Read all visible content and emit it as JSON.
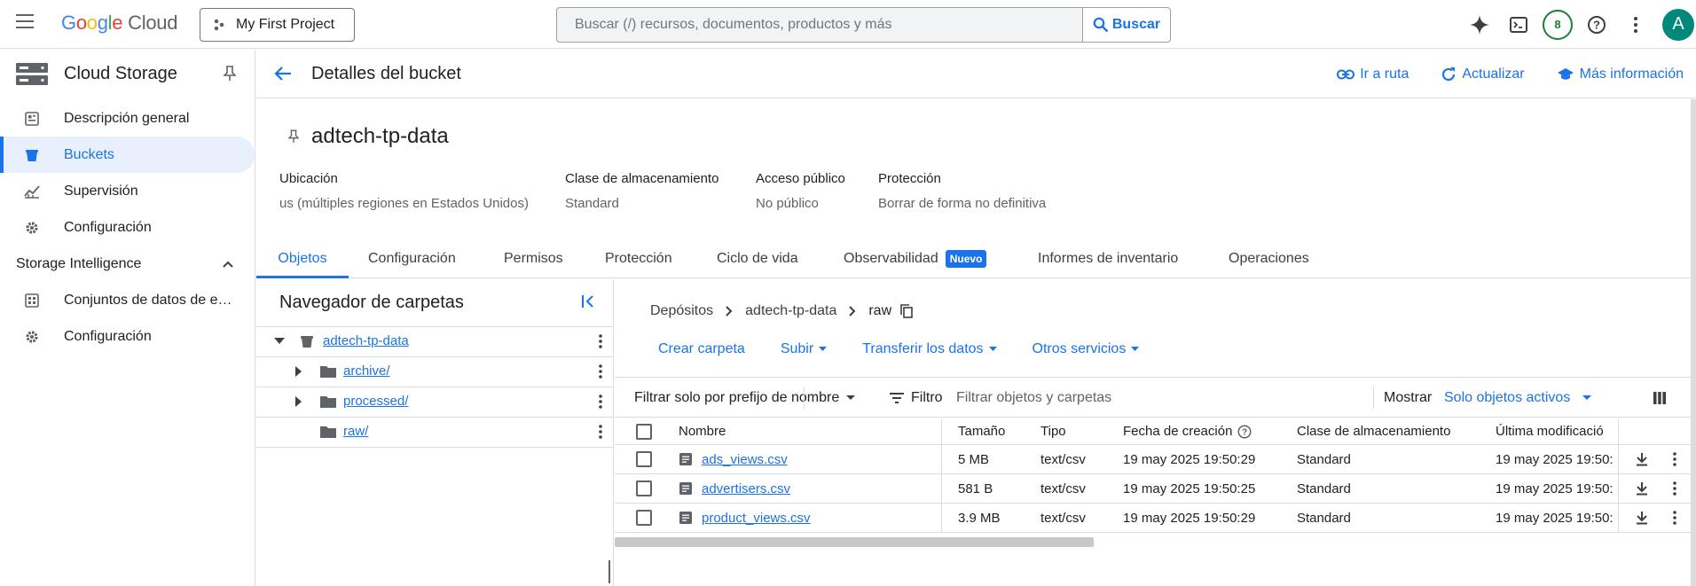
{
  "topbar": {
    "logo_google": "Google",
    "logo_cloud": "Cloud",
    "project_label": "My First Project",
    "search_placeholder": "Buscar (/) recursos, documentos, productos y más",
    "search_button": "Buscar",
    "notifications_count": "8",
    "avatar_letter": "A"
  },
  "sidebar": {
    "title": "Cloud Storage",
    "items": [
      {
        "label": "Descripción general",
        "icon": "dashboard-icon"
      },
      {
        "label": "Buckets",
        "icon": "bucket-icon",
        "active": true
      },
      {
        "label": "Supervisión",
        "icon": "monitoring-icon"
      },
      {
        "label": "Configuración",
        "icon": "gear-icon"
      }
    ],
    "section_title": "Storage Intelligence",
    "section_items": [
      {
        "label": "Conjuntos de datos de es…",
        "icon": "datasets-icon"
      },
      {
        "label": "Configuración",
        "icon": "gear-icon"
      }
    ]
  },
  "header": {
    "title": "Detalles del bucket",
    "actions": [
      {
        "label": "Ir a ruta",
        "icon": "link-icon"
      },
      {
        "label": "Actualizar",
        "icon": "refresh-icon"
      },
      {
        "label": "Más información",
        "icon": "school-icon"
      }
    ]
  },
  "bucket": {
    "name": "adtech-tp-data",
    "properties": [
      {
        "label": "Ubicación",
        "value": "us (múltiples regiones en Estados Unidos)"
      },
      {
        "label": "Clase de almacenamiento",
        "value": "Standard"
      },
      {
        "label": "Acceso público",
        "value": "No público"
      },
      {
        "label": "Protección",
        "value": "Borrar de forma no definitiva"
      }
    ]
  },
  "tabs": [
    {
      "label": "Objetos",
      "active": true
    },
    {
      "label": "Configuración"
    },
    {
      "label": "Permisos"
    },
    {
      "label": "Protección"
    },
    {
      "label": "Ciclo de vida"
    },
    {
      "label": "Observabilidad",
      "badge": "Nuevo"
    },
    {
      "label": "Informes de inventario"
    },
    {
      "label": "Operaciones"
    }
  ],
  "folder_browser": {
    "title": "Navegador de carpetas",
    "root": "adtech-tp-data",
    "folders": [
      "archive/",
      "processed/",
      "raw/"
    ]
  },
  "breadcrumb": [
    "Depósitos",
    "adtech-tp-data",
    "raw"
  ],
  "object_actions": [
    "Crear carpeta",
    "Subir",
    "Transferir los datos",
    "Otros servicios"
  ],
  "filter_bar": {
    "prefix_filter": "Filtrar solo por prefijo de nombre",
    "filter_label": "Filtro",
    "filter_placeholder": "Filtrar objetos y carpetas",
    "show_label": "Mostrar",
    "show_value": "Solo objetos activos"
  },
  "table": {
    "columns": [
      "Nombre",
      "Tamaño",
      "Tipo",
      "Fecha de creación",
      "Clase de almacenamiento",
      "Última modificació"
    ],
    "rows": [
      {
        "name": "ads_views.csv",
        "size": "5 MB",
        "type": "text/csv",
        "created": "19 may 2025 19:50:29",
        "class": "Standard",
        "modified": "19 may 2025 19:50:"
      },
      {
        "name": "advertisers.csv",
        "size": "581 B",
        "type": "text/csv",
        "created": "19 may 2025 19:50:25",
        "class": "Standard",
        "modified": "19 may 2025 19:50:"
      },
      {
        "name": "product_views.csv",
        "size": "3.9 MB",
        "type": "text/csv",
        "created": "19 may 2025 19:50:29",
        "class": "Standard",
        "modified": "19 may 2025 19:50:"
      }
    ]
  },
  "colors": {
    "accent": "#1a73e8",
    "active_bg": "#e8f0fe",
    "border": "#dadce0"
  }
}
